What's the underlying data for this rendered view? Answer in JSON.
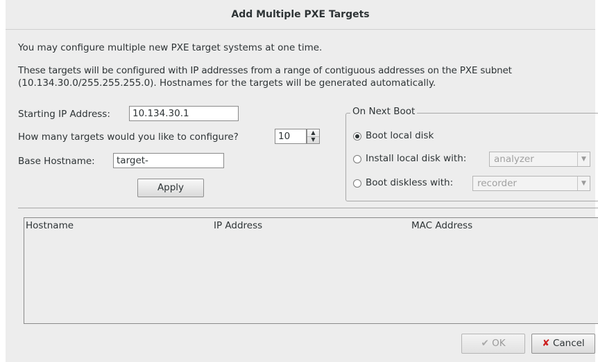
{
  "dialog": {
    "title": "Add Multiple PXE Targets",
    "intro": "You may configure multiple new PXE target systems at one time.",
    "description_line1": "These targets will be configured with IP addresses from a range of contiguous addresses on the PXE subnet",
    "description_line2": "(10.134.30.0/255.255.255.0).  Hostnames for the targets will be generated automatically."
  },
  "form": {
    "starting_ip_label": "Starting IP Address:",
    "starting_ip_value": "10.134.30.1",
    "count_label": "How many targets would you like to configure?",
    "count_value": "10",
    "base_hostname_label": "Base Hostname:",
    "base_hostname_value": "target-",
    "apply_label": "Apply"
  },
  "next_boot": {
    "label": "On Next Boot",
    "options": [
      {
        "label": "Boot local disk",
        "selected": true
      },
      {
        "label": "Install local disk with:",
        "selected": false,
        "combo_value": "analyzer"
      },
      {
        "label": "Boot diskless with:",
        "selected": false,
        "combo_value": "recorder"
      }
    ]
  },
  "targets_table": {
    "columns": [
      "Hostname",
      "IP Address",
      "MAC Address"
    ],
    "rows": []
  },
  "footer": {
    "ok_label": "OK",
    "cancel_label": "Cancel"
  },
  "icons": {
    "ok": "apply-check-icon",
    "cancel": "red-x-icon",
    "spin_up": "arrow-up-icon",
    "spin_down": "arrow-down-icon",
    "combo_arrow": "chevron-down-icon"
  }
}
